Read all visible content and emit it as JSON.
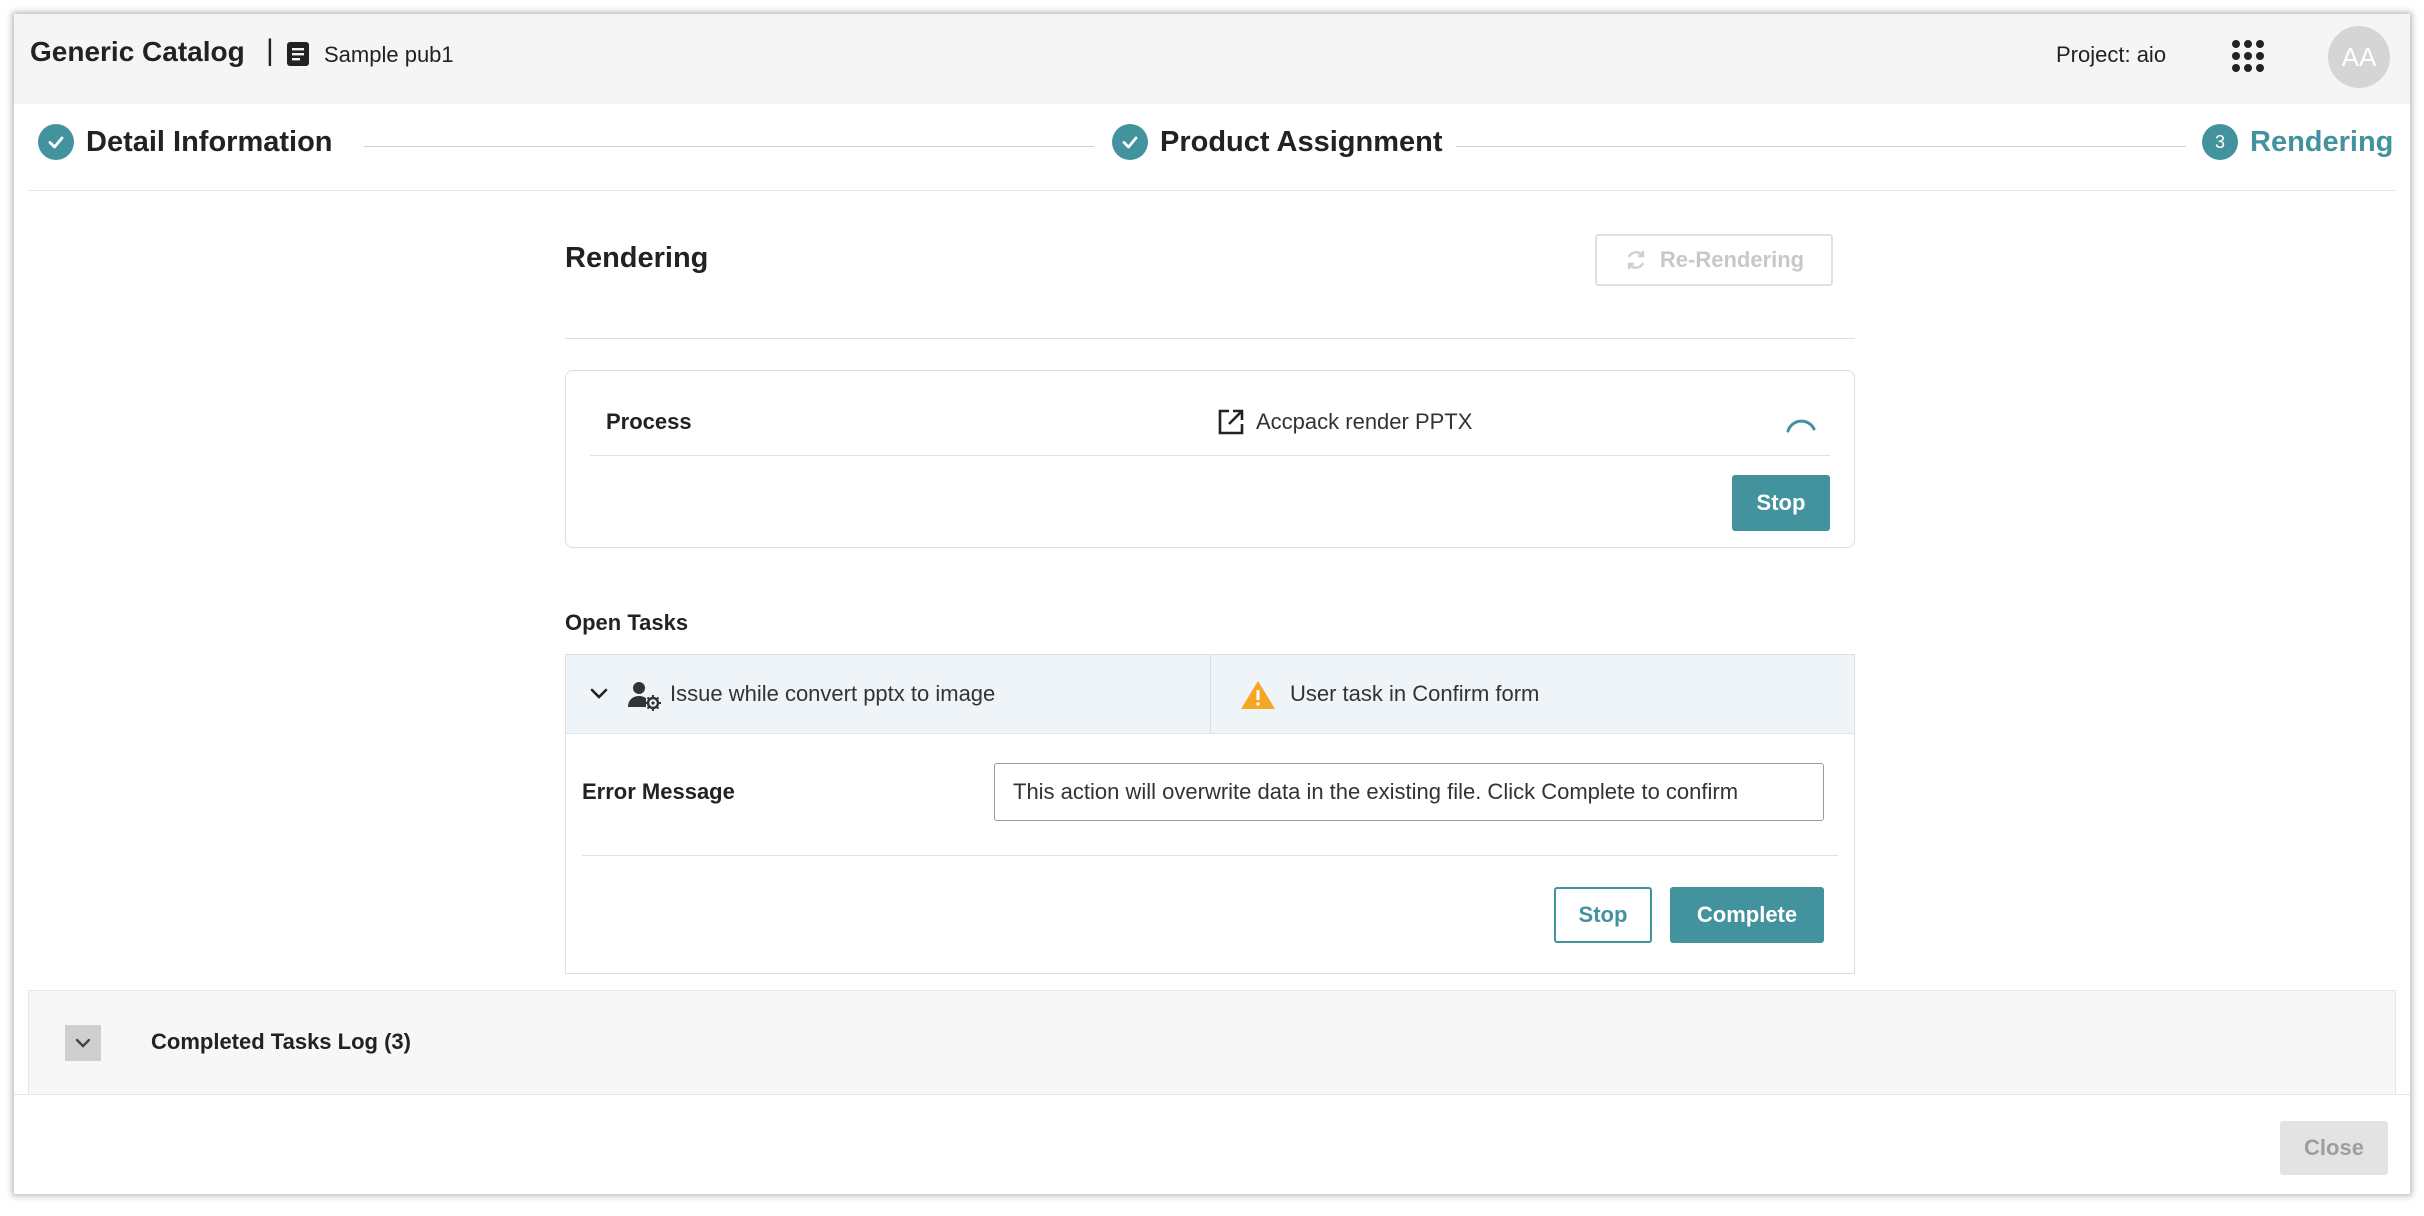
{
  "header": {
    "app_title": "Generic Catalog",
    "separator": "|",
    "publication_name": "Sample pub1",
    "project_label": "Project: aio",
    "avatar_initials": "AA"
  },
  "stepper": {
    "steps": [
      {
        "label": "Detail Information",
        "status": "completed"
      },
      {
        "label": "Product Assignment",
        "status": "completed"
      },
      {
        "label": "Rendering",
        "status": "active",
        "number": "3"
      }
    ]
  },
  "rendering": {
    "title": "Rendering",
    "rerender_label": "Re-Rendering",
    "process": {
      "label": "Process",
      "name": "Accpack render PPTX",
      "stop_label": "Stop"
    }
  },
  "open_tasks": {
    "title": "Open Tasks",
    "task": {
      "name": "Issue while convert pptx to image",
      "status": "User task in Confirm form",
      "error_label": "Error Message",
      "error_value": "This action will overwrite data in the existing file. Click Complete to confirm",
      "stop_label": "Stop",
      "complete_label": "Complete"
    }
  },
  "completed_log": {
    "title": "Completed Tasks Log (3)"
  },
  "footer": {
    "close_label": "Close"
  },
  "colors": {
    "accent": "#43939e",
    "warning": "#f5a623",
    "task_header_bg": "#eef4f7"
  }
}
